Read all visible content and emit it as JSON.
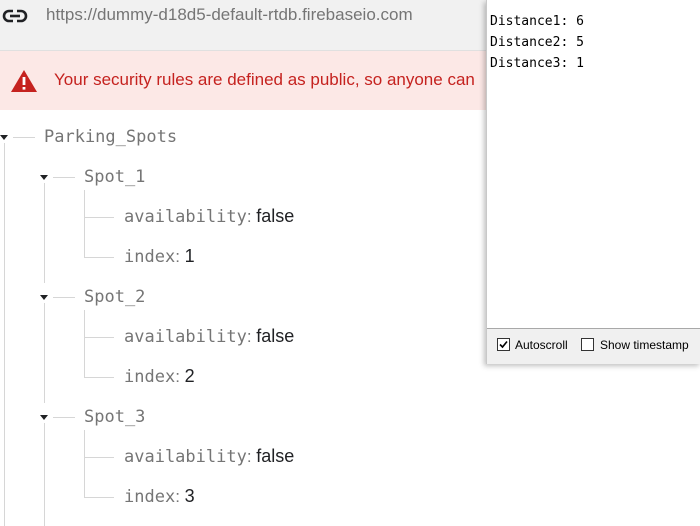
{
  "urlbar": {
    "url": "https://dummy-d18d5-default-rtdb.firebaseio.com",
    "icon": "link-icon"
  },
  "warning": {
    "text": "Your security rules are defined as public, so anyone can",
    "icon": "warning-triangle-icon",
    "color": "#c5221f",
    "background": "#fce8e6"
  },
  "tree": {
    "root_key": "Parking_Spots",
    "spots": [
      {
        "key": "Spot_1",
        "availability_key": "availability",
        "availability": "false",
        "index_key": "index",
        "index": "1"
      },
      {
        "key": "Spot_2",
        "availability_key": "availability",
        "availability": "false",
        "index_key": "index",
        "index": "2"
      },
      {
        "key": "Spot_3",
        "availability_key": "availability",
        "availability": "false",
        "index_key": "index",
        "index": "3"
      }
    ],
    "separator": ":"
  },
  "serial": {
    "lines": [
      "Distance1: 6",
      "Distance2: 5",
      "Distance3: 1"
    ],
    "autoscroll_label": "Autoscroll",
    "autoscroll_checked": true,
    "timestamp_label": "Show timestamp",
    "timestamp_checked": false
  }
}
